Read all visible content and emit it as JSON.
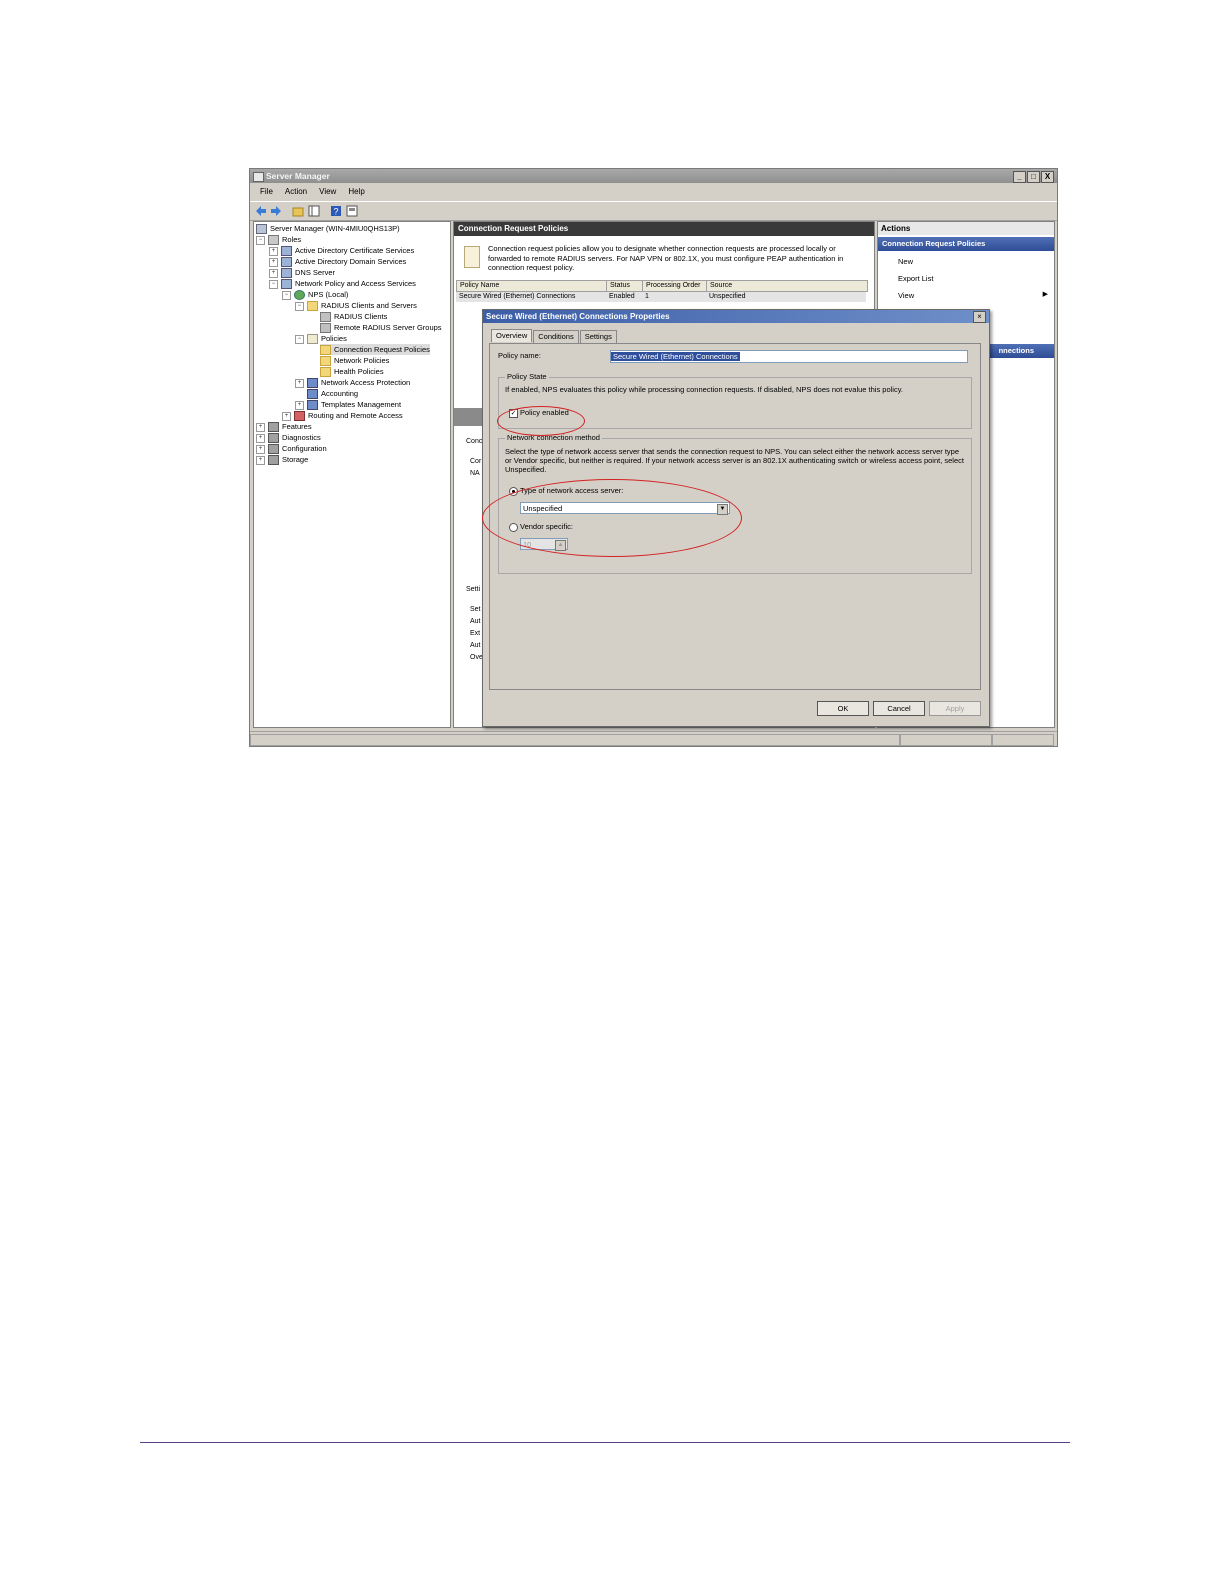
{
  "window": {
    "title": "Server Manager",
    "controls": [
      "_",
      "□",
      "X"
    ]
  },
  "menu": [
    "File",
    "Action",
    "View",
    "Help"
  ],
  "tree": [
    {
      "label": "Server Manager (WIN-4MIU0QHS13P)",
      "level": 0,
      "expander": "",
      "icon": "server-icon"
    },
    {
      "label": "Roles",
      "level": 1,
      "expander": "−",
      "icon": "roles-icon"
    },
    {
      "label": "Active Directory Certificate Services",
      "level": 2,
      "expander": "+",
      "icon": "service-icon"
    },
    {
      "label": "Active Directory Domain Services",
      "level": 2,
      "expander": "+",
      "icon": "service-icon"
    },
    {
      "label": "DNS Server",
      "level": 2,
      "expander": "+",
      "icon": "service-icon"
    },
    {
      "label": "Network Policy and Access Services",
      "level": 2,
      "expander": "−",
      "icon": "service-icon"
    },
    {
      "label": "NPS (Local)",
      "level": 3,
      "expander": "−",
      "icon": "globe-icon"
    },
    {
      "label": "RADIUS Clients and Servers",
      "level": 4,
      "expander": "−",
      "icon": "folder-icon"
    },
    {
      "label": "RADIUS Clients",
      "level": 5,
      "expander": "",
      "icon": "server-icon"
    },
    {
      "label": "Remote RADIUS Server Groups",
      "level": 5,
      "expander": "",
      "icon": "server-icon"
    },
    {
      "label": "Policies",
      "level": 4,
      "expander": "−",
      "icon": "policy-icon"
    },
    {
      "label": "Connection Request Policies",
      "level": 5,
      "expander": "",
      "icon": "folder-icon"
    },
    {
      "label": "Network Policies",
      "level": 5,
      "expander": "",
      "icon": "folder-icon"
    },
    {
      "label": "Health Policies",
      "level": 5,
      "expander": "",
      "icon": "folder-icon"
    },
    {
      "label": "Network Access Protection",
      "level": 4,
      "expander": "+",
      "icon": "service-icon"
    },
    {
      "label": "Accounting",
      "level": 4,
      "expander": "",
      "icon": "service-icon"
    },
    {
      "label": "Templates Management",
      "level": 4,
      "expander": "+",
      "icon": "service-icon"
    },
    {
      "label": "Routing and Remote Access",
      "level": 3,
      "expander": "+",
      "icon": "service-icon"
    },
    {
      "label": "Features",
      "level": 0,
      "expander": "+",
      "icon": "features-icon"
    },
    {
      "label": "Diagnostics",
      "level": 0,
      "expander": "+",
      "icon": "diagnostics-icon"
    },
    {
      "label": "Configuration",
      "level": 0,
      "expander": "+",
      "icon": "config-icon"
    },
    {
      "label": "Storage",
      "level": 0,
      "expander": "+",
      "icon": "storage-icon"
    }
  ],
  "center": {
    "header": "Connection Request Policies",
    "description": "Connection request policies allow you to designate whether connection requests are processed locally or forwarded to remote RADIUS servers. For NAP VPN or 802.1X, you must configure PEAP authentication in connection request policy.",
    "columns": [
      "Policy Name",
      "Status",
      "Processing Order",
      "Source"
    ],
    "rows": [
      [
        "Secure Wired (Ethernet) Connections",
        "Enabled",
        "1",
        "Unspecified"
      ]
    ],
    "fragments": [
      "Conc",
      "Cor",
      "NA",
      "Setti",
      "Set",
      "Aut",
      "Ext",
      "Aut",
      "Ove"
    ]
  },
  "actions": {
    "title": "Actions",
    "section1": "Connection Request Policies",
    "items": [
      "New",
      "Export List",
      "View"
    ],
    "section2": "nnections"
  },
  "dialog": {
    "title": "Secure Wired (Ethernet) Connections Properties",
    "tabs": [
      "Overview",
      "Conditions",
      "Settings"
    ],
    "policy_name_label": "Policy name:",
    "policy_name_value": "Secure Wired (Ethernet) Connections",
    "policy_state": {
      "title": "Policy State",
      "text": "If enabled, NPS evaluates this policy while processing connection requests. If disabled, NPS does not evalue this policy.",
      "checkbox_label": "Policy enabled",
      "checked": true
    },
    "network_method": {
      "title": "Network connection method",
      "text": "Select the type of network access server that sends the connection request to NPS. You can select either the network access server type or Vendor specific, but neither is required.  If your network access server is an 802.1X authenticating switch or wireless access point, select Unspecified.",
      "radio1_label": "Type of network access server:",
      "select_value": "Unspecified",
      "radio2_label": "Vendor specific:",
      "vendor_value": "10"
    },
    "buttons": {
      "ok": "OK",
      "cancel": "Cancel",
      "apply": "Apply"
    }
  },
  "colors": {
    "highlight_circle": "#d42020",
    "title_blue": "#3c5ea6",
    "selection": "#2f4f9c"
  }
}
